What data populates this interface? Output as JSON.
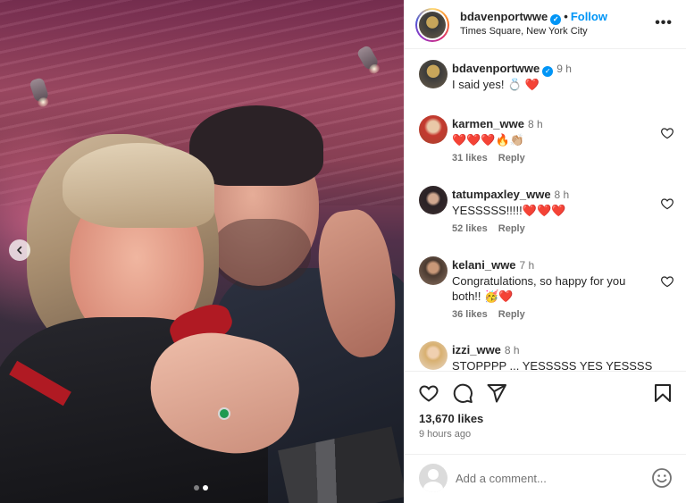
{
  "post": {
    "username": "bdavenportwwe",
    "follow_label": "Follow",
    "location": "Times Square, New York City",
    "more_label": "•••",
    "separator": "•"
  },
  "photo": {
    "prev_icon": "chevron-left-icon",
    "carousel_total": 2,
    "carousel_active": 2
  },
  "comments": [
    {
      "username": "bdavenportwwe",
      "verified": true,
      "time": "9 h",
      "text": "I said yes! 💍 ❤️",
      "likes": "",
      "reply": ""
    },
    {
      "username": "karmen_wwe",
      "verified": false,
      "time": "8 h",
      "text": "❤️❤️❤️🔥👏🏼",
      "likes": "31 likes",
      "reply": "Reply"
    },
    {
      "username": "tatumpaxley_wwe",
      "verified": false,
      "time": "8 h",
      "text": "YESSSSS!!!!!❤️❤️❤️",
      "likes": "52 likes",
      "reply": "Reply"
    },
    {
      "username": "kelani_wwe",
      "verified": false,
      "time": "7 h",
      "text": "Congratulations, so happy for you both!! 🥳❤️",
      "likes": "36 likes",
      "reply": "Reply"
    },
    {
      "username": "izzi_wwe",
      "verified": false,
      "time": "8 h",
      "text": "STOPPPP ... YESSSSS YES YESSSS",
      "likes": "",
      "reply": ""
    }
  ],
  "actions": {
    "likes": "13,670 likes",
    "time_ago": "9 hours ago"
  },
  "add_comment": {
    "placeholder": "Add a comment..."
  },
  "colors": {
    "accent": "#0095f6",
    "text": "#262626",
    "muted": "#737373",
    "heart": "#ed4956"
  }
}
